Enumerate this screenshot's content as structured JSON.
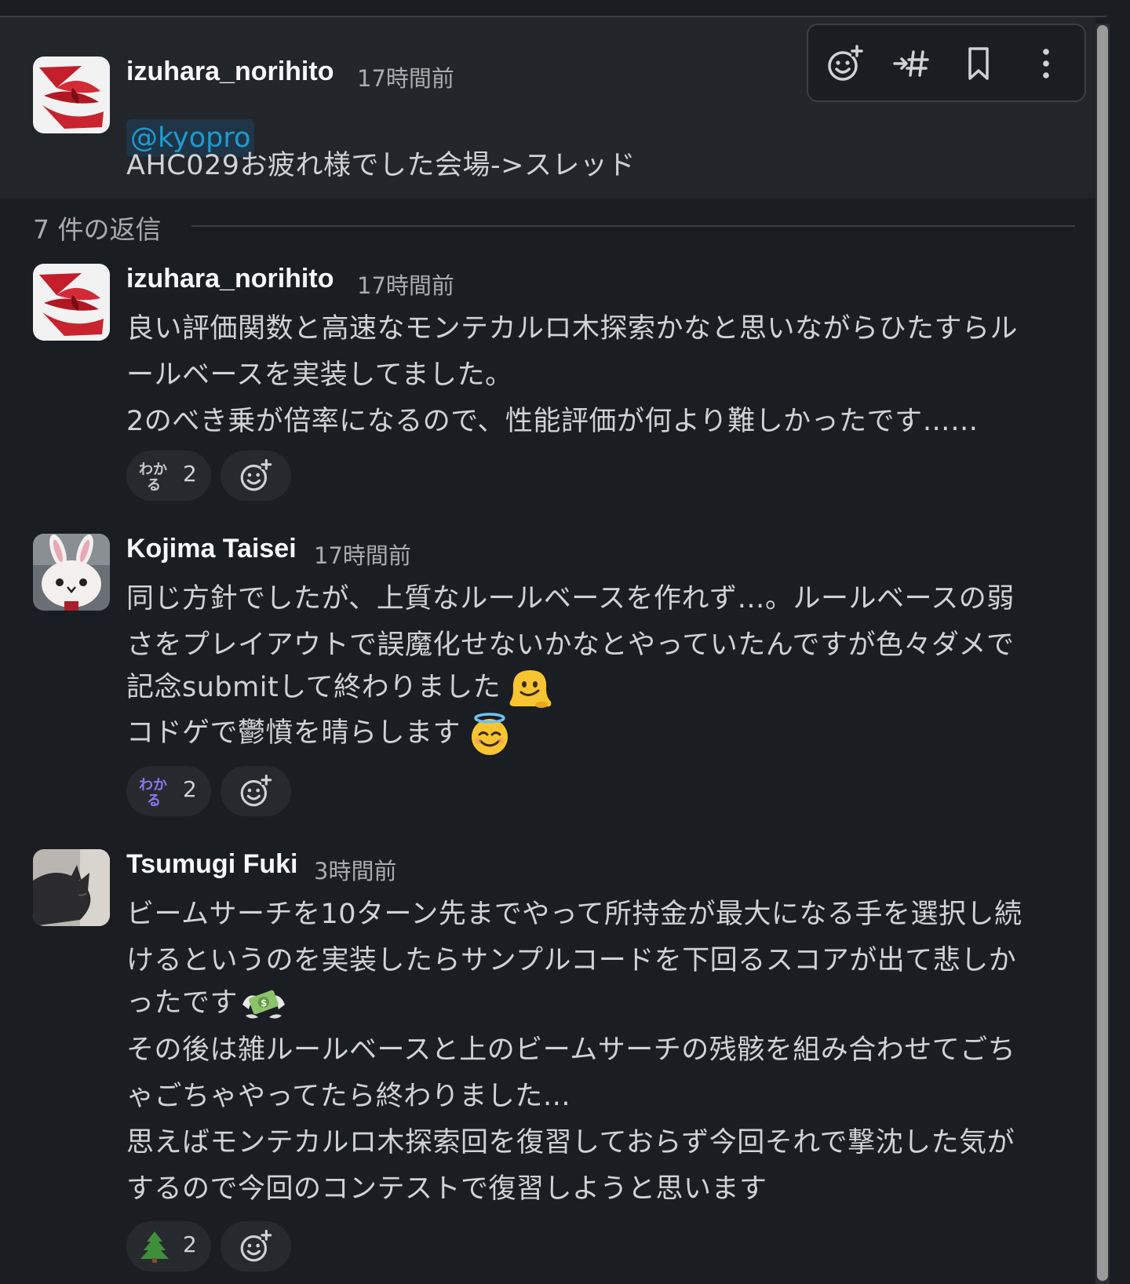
{
  "parent": {
    "author": "izuhara_norihito",
    "time": "17時間前",
    "mention": "@kyopro",
    "text": "AHC029お疲れ様でした会場->スレッド"
  },
  "toolbar": {
    "icons": [
      "add-reaction-icon",
      "forward-to-channel-icon",
      "bookmark-icon",
      "more-actions-icon"
    ]
  },
  "replies_label": "7 件の返信",
  "messages": [
    {
      "author": "izuhara_norihito",
      "time": "17時間前",
      "lines": [
        "良い評価関数と高速なモンテカルロ木探索かなと思いながらひたすらル",
        "ールベースを実装してました。",
        "2のべき乗が倍率になるので、性能評価が何より難しかったです……"
      ],
      "reaction": {
        "emoji": "wakaru",
        "count": "2"
      }
    },
    {
      "author": "Kojima Taisei",
      "time": "17時間前",
      "lines": [
        "同じ方針でしたが、上質なルールベースを作れず…。ルールベースの弱",
        "さをプレイアウトで誤魔化せないかなとやっていたんですが色々ダメで",
        "記念submitして終わりました",
        "コドゲで鬱憤を晴らします"
      ],
      "inline_emojis": [
        "melting-face",
        "smiling-face-with-halo"
      ],
      "reaction": {
        "emoji": "wakaru",
        "count": "2"
      }
    },
    {
      "author": "Tsumugi Fuki",
      "time": "3時間前",
      "lines": [
        "ビームサーチを10ターン先までやって所持金が最大になる手を選択し続",
        "けるというのを実装したらサンプルコードを下回るスコアが出て悲しか",
        "ったです",
        "その後は雑ルールベースと上のビームサーチの残骸を組み合わせてごち",
        "ゃごちゃやってたら終わりました…",
        "思えばモンテカルロ木探索回を復習しておらず今回それで撃沈した気が",
        "するので今回のコンテストで復習しようと思います"
      ],
      "inline_emojis": [
        "money-with-wings"
      ],
      "reaction": {
        "emoji": "evergreen-tree",
        "count": "2"
      }
    }
  ],
  "colors": {
    "background": "#1a1d21",
    "parent_background": "#222529",
    "mention_text": "#1d9bd1",
    "mention_background": "#1f3446",
    "name": "#f8f8f8",
    "secondary_text": "#ababad"
  }
}
